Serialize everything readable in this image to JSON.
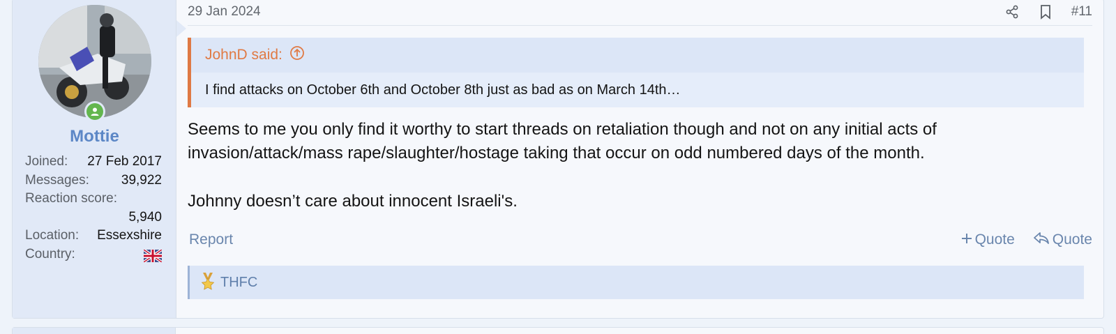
{
  "user": {
    "name": "Mottie",
    "stats": [
      {
        "label": "Joined:",
        "value": "27 Feb 2017"
      },
      {
        "label": "Messages:",
        "value": "39,922"
      },
      {
        "label": "Reaction score:",
        "value": "5,940"
      },
      {
        "label": "Location:",
        "value": "Essexshire"
      },
      {
        "label": "Country:",
        "value": "uk-flag"
      }
    ],
    "online_status_color": "#63b64e"
  },
  "post": {
    "date": "29 Jan 2024",
    "number": "#11",
    "quote": {
      "author": "JohnD said:",
      "text": "I find attacks on October 6th and October 8th just as bad as on March 14th…"
    },
    "message": [
      "Seems to me you only find it worthy to start threads on retaliation though and not on any initial acts of invasion/attack/mass rape/slaughter/hostage taking that occur on odd numbered days of the month.",
      "Johnny doesn’t care about innocent Israeli's."
    ],
    "footer": {
      "report": "Report",
      "multi_quote": "Quote",
      "quote": "Quote"
    },
    "reaction": {
      "icon": "trophy-star-icon",
      "users": "THFC"
    }
  },
  "colors": {
    "accent": "#5c87c6",
    "quote_border": "#df7944",
    "link": "#6a86ad"
  }
}
